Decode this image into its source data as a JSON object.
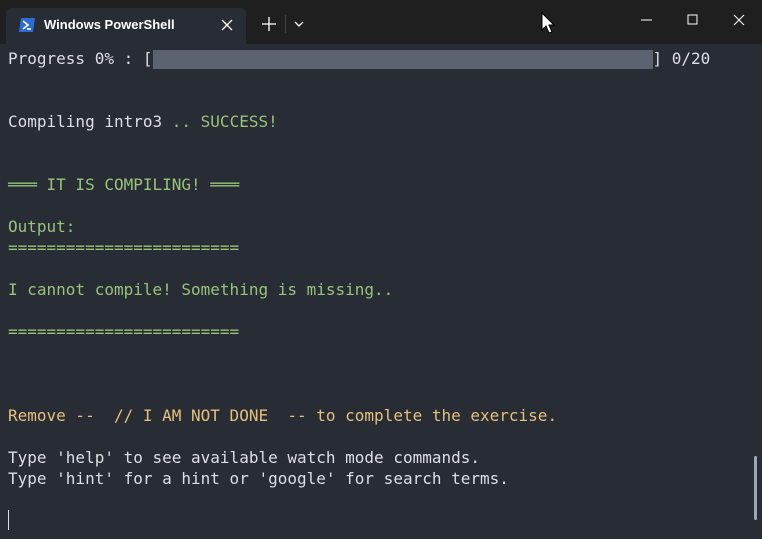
{
  "window": {
    "tab_title": "Windows PowerShell",
    "icons": {
      "app": "powershell-icon",
      "tab_close": "close-icon",
      "new_tab": "plus-icon",
      "dropdown": "chevron-down-icon",
      "minimize": "minimize-icon",
      "maximize": "maximize-icon",
      "close": "close-icon"
    }
  },
  "terminal": {
    "progress": {
      "prefix": "Progress 0% : [",
      "suffix": "] 0/20",
      "percent": 0,
      "done": 0,
      "total": 20
    },
    "compile": {
      "text": "Compiling intro3",
      "dots": " ..",
      "status": " SUCCESS!"
    },
    "banner": "═══ IT IS COMPILING! ═══",
    "output_label": "Output:",
    "separator": "========================",
    "message": "I cannot compile! Something is missing..",
    "separator2": "========================",
    "remove_hint": "Remove --  // I AM NOT DONE  -- to complete the exercise.",
    "help_line": "Type 'help' to see available watch mode commands.",
    "hint_line": "Type 'hint' for a hint or 'google' for search terms."
  },
  "colors": {
    "background": "#282c34",
    "titlebar": "#1f1f1f",
    "text": "#dcdfe4",
    "green": "#98c379",
    "orange": "#e5c07b",
    "progress_bar": "#5c6370"
  }
}
